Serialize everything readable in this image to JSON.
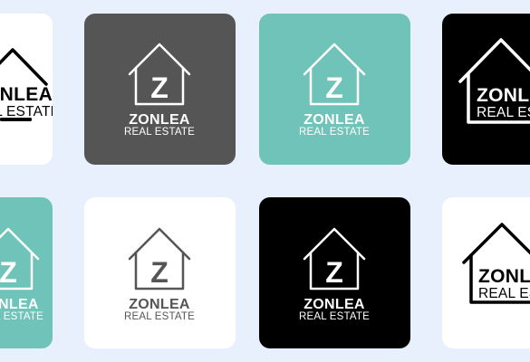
{
  "brand": {
    "name": "ZONLEA",
    "subtitle": "REAL ESTATE",
    "monogram": "Z"
  },
  "colors": {
    "page_background": "#e8f0fd",
    "white": "#ffffff",
    "dark_gray": "#555555",
    "teal": "#6fc3b9",
    "black": "#000000",
    "mark_gray": "#555555"
  },
  "tiles": [
    {
      "variant": "cropped-left",
      "background": "#ffffff",
      "mark_color": "#000000"
    },
    {
      "variant": "standard",
      "background": "#555555",
      "mark_color": "#ffffff"
    },
    {
      "variant": "standard",
      "background": "#6fc3b9",
      "mark_color": "#ffffff"
    },
    {
      "variant": "cropped-right",
      "background": "#000000",
      "mark_color": "#ffffff"
    },
    {
      "variant": "cropped-left",
      "background": "#6fc3b9",
      "mark_color": "#ffffff"
    },
    {
      "variant": "standard",
      "background": "#ffffff",
      "mark_color": "#555555"
    },
    {
      "variant": "standard",
      "background": "#000000",
      "mark_color": "#ffffff"
    },
    {
      "variant": "cropped-right",
      "background": "#ffffff",
      "mark_color": "#000000"
    }
  ]
}
